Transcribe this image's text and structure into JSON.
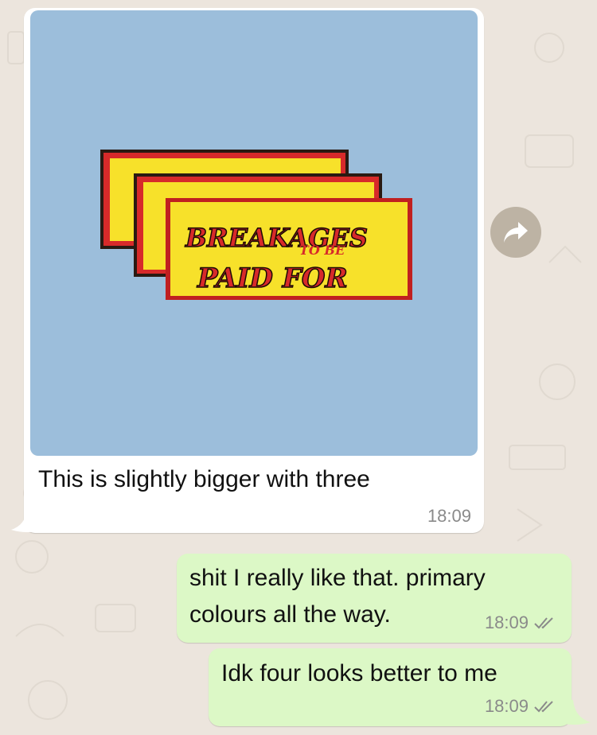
{
  "incoming": {
    "image_text_line1": "BREAKAGES",
    "image_text_line2": "TO BE",
    "image_text_line3": "PAID FOR",
    "caption": "This is slightly bigger with three",
    "time": "18:09"
  },
  "outgoing": [
    {
      "text": "shit I really like that. primary colours all the way.",
      "time": "18:09"
    },
    {
      "text": "Idk four looks better to me",
      "time": "18:09"
    }
  ],
  "icons": {
    "forward": "forward-arrow-icon",
    "read_receipt": "double-check-icon"
  },
  "colors": {
    "background": "#ece5dd",
    "incoming_bubble": "#ffffff",
    "outgoing_bubble": "#dcf8c6",
    "photo_background": "#9cbedb",
    "sign_yellow": "#f7e12a",
    "sign_red": "#d72a2a",
    "tick_grey": "#8a8a8a"
  }
}
